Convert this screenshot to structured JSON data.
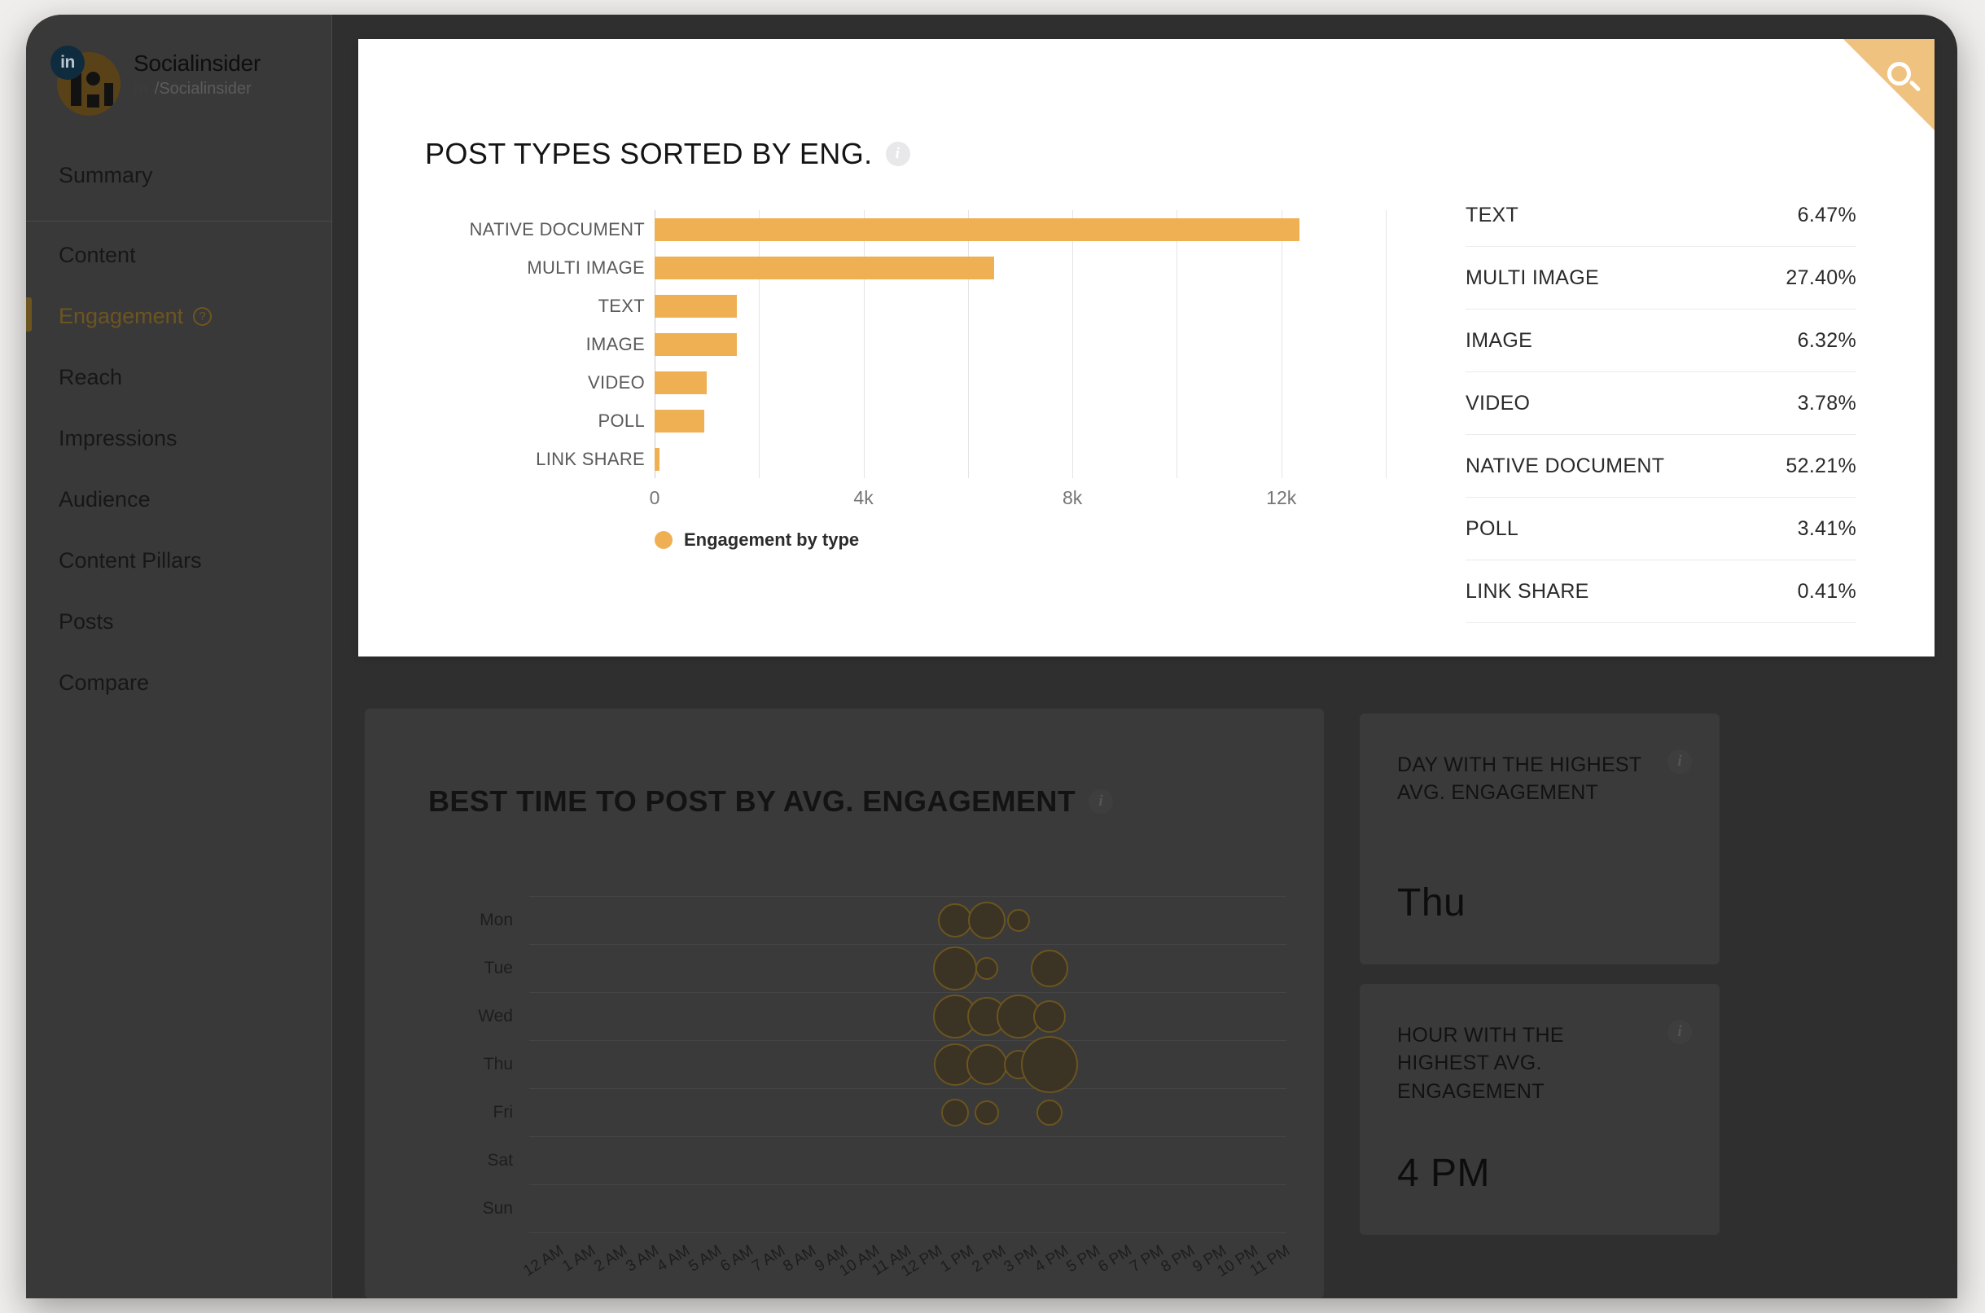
{
  "brand": {
    "name": "Socialinsider",
    "network_short": "in",
    "handle": "/Socialinsider",
    "avatar_icon": "linkedin-avatar",
    "badge_icon": "linkedin-badge-icon"
  },
  "sidebar": {
    "items": [
      {
        "label": "Summary",
        "active": false
      },
      {
        "label": "Content",
        "active": false
      },
      {
        "label": "Engagement",
        "active": true,
        "help_icon": "question-mark-icon"
      },
      {
        "label": "Reach",
        "active": false
      },
      {
        "label": "Impressions",
        "active": false
      },
      {
        "label": "Audience",
        "active": false
      },
      {
        "label": "Content Pillars",
        "active": false
      },
      {
        "label": "Posts",
        "active": false
      },
      {
        "label": "Compare",
        "active": false
      }
    ]
  },
  "top_card": {
    "title": "POST TYPES SORTED BY ENG.",
    "info_icon": "info-icon",
    "search_icon": "search-icon",
    "accent_color": "#efb054",
    "percent_header": null,
    "percents": [
      {
        "label": "TEXT",
        "value": "6.47%"
      },
      {
        "label": "MULTI IMAGE",
        "value": "27.40%"
      },
      {
        "label": "IMAGE",
        "value": "6.32%"
      },
      {
        "label": "VIDEO",
        "value": "3.78%"
      },
      {
        "label": "NATIVE DOCUMENT",
        "value": "52.21%"
      },
      {
        "label": "POLL",
        "value": "3.41%"
      },
      {
        "label": "LINK SHARE",
        "value": "0.41%"
      }
    ]
  },
  "bubble_card": {
    "title": "BEST TIME TO POST BY AVG. ENGAGEMENT",
    "info_icon": "info-icon"
  },
  "stats": [
    {
      "title": "DAY WITH THE HIGHEST AVG. ENGAGEMENT",
      "value": "Thu",
      "info_icon": "info-icon"
    },
    {
      "title": "HOUR WITH THE HIGHEST AVG. ENGAGEMENT",
      "value": "4 PM",
      "info_icon": "info-icon"
    }
  ],
  "chart_data": [
    {
      "type": "bar",
      "orientation": "horizontal",
      "title": "POST TYPES SORTED BY ENG.",
      "xlabel": "",
      "ylabel": "",
      "categories": [
        "NATIVE DOCUMENT",
        "MULTI IMAGE",
        "TEXT",
        "IMAGE",
        "VIDEO",
        "POLL",
        "LINK SHARE"
      ],
      "values": [
        12350,
        6500,
        1580,
        1580,
        1000,
        950,
        100
      ],
      "series": [
        {
          "name": "Engagement by type",
          "values": [
            12350,
            6500,
            1580,
            1580,
            1000,
            950,
            100
          ]
        }
      ],
      "xticks": [
        "0",
        "4k",
        "8k",
        "12k"
      ],
      "xtick_values": [
        0,
        4000,
        8000,
        12000
      ],
      "xlim": [
        0,
        14000
      ],
      "grid": true,
      "legend": {
        "position": "bottom",
        "entries": [
          "Engagement by type"
        ]
      },
      "color": "#efb054"
    },
    {
      "type": "scatter",
      "variant": "bubble",
      "title": "BEST TIME TO POST BY AVG. ENGAGEMENT",
      "xlabel": "",
      "ylabel": "",
      "x": [
        "12 AM",
        "1 AM",
        "2 AM",
        "3 AM",
        "4 AM",
        "5 AM",
        "6 AM",
        "7 AM",
        "8 AM",
        "9 AM",
        "10 AM",
        "11 AM",
        "12 PM",
        "1 PM",
        "2 PM",
        "3 PM",
        "4 PM",
        "5 PM",
        "6 PM",
        "7 PM",
        "8 PM",
        "9 PM",
        "10 PM",
        "11 PM"
      ],
      "y": [
        "Mon",
        "Tue",
        "Wed",
        "Thu",
        "Fri",
        "Sat",
        "Sun"
      ],
      "grid": true,
      "legend": {
        "position": "none",
        "entries": []
      },
      "color": "#3b3323",
      "points": [
        {
          "day": "Mon",
          "hour": "1 PM",
          "size": 21
        },
        {
          "day": "Mon",
          "hour": "2 PM",
          "size": 23
        },
        {
          "day": "Mon",
          "hour": "3 PM",
          "size": 14
        },
        {
          "day": "Tue",
          "hour": "1 PM",
          "size": 27
        },
        {
          "day": "Tue",
          "hour": "2 PM",
          "size": 14
        },
        {
          "day": "Tue",
          "hour": "4 PM",
          "size": 23
        },
        {
          "day": "Wed",
          "hour": "1 PM",
          "size": 27
        },
        {
          "day": "Wed",
          "hour": "2 PM",
          "size": 24
        },
        {
          "day": "Wed",
          "hour": "3 PM",
          "size": 27
        },
        {
          "day": "Wed",
          "hour": "4 PM",
          "size": 20
        },
        {
          "day": "Thu",
          "hour": "1 PM",
          "size": 26
        },
        {
          "day": "Thu",
          "hour": "2 PM",
          "size": 25
        },
        {
          "day": "Thu",
          "hour": "3 PM",
          "size": 18
        },
        {
          "day": "Thu",
          "hour": "4 PM",
          "size": 35
        },
        {
          "day": "Fri",
          "hour": "1 PM",
          "size": 17
        },
        {
          "day": "Fri",
          "hour": "2 PM",
          "size": 15
        },
        {
          "day": "Fri",
          "hour": "4 PM",
          "size": 16
        }
      ]
    }
  ]
}
